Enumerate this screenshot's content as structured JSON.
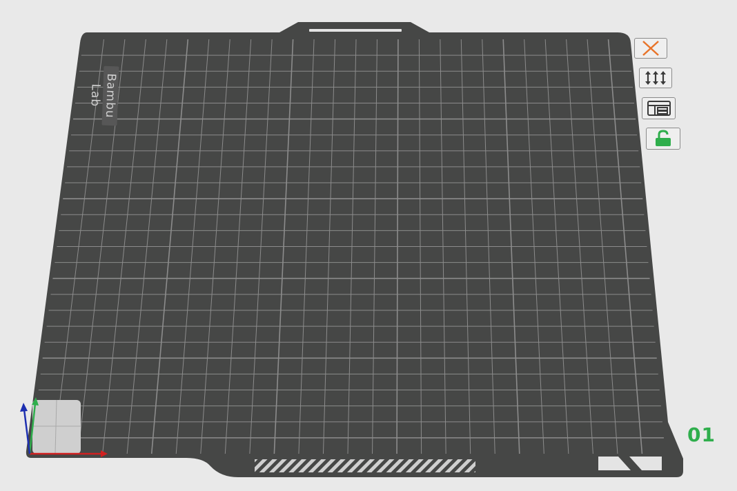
{
  "viewport": {
    "brand": "Bambu Lab",
    "plate_number": "01",
    "colors": {
      "background": "#e9e9e9",
      "plate": "#464746",
      "grid_line": "#8c8c8c",
      "remove_icon": "#e8742a",
      "lock_icon": "#2fae4c",
      "plate_number": "#2fae4c",
      "axis_x": "#d02020",
      "axis_y": "#2fae4c",
      "axis_z": "#1d2fb0"
    },
    "toolbar": [
      {
        "name": "remove-plate-button",
        "icon": "close-icon"
      },
      {
        "name": "arrange-plate-button",
        "icon": "arrange-icon"
      },
      {
        "name": "plate-settings-button",
        "icon": "plate-settings-icon"
      },
      {
        "name": "lock-plate-button",
        "icon": "unlock-icon"
      }
    ]
  }
}
